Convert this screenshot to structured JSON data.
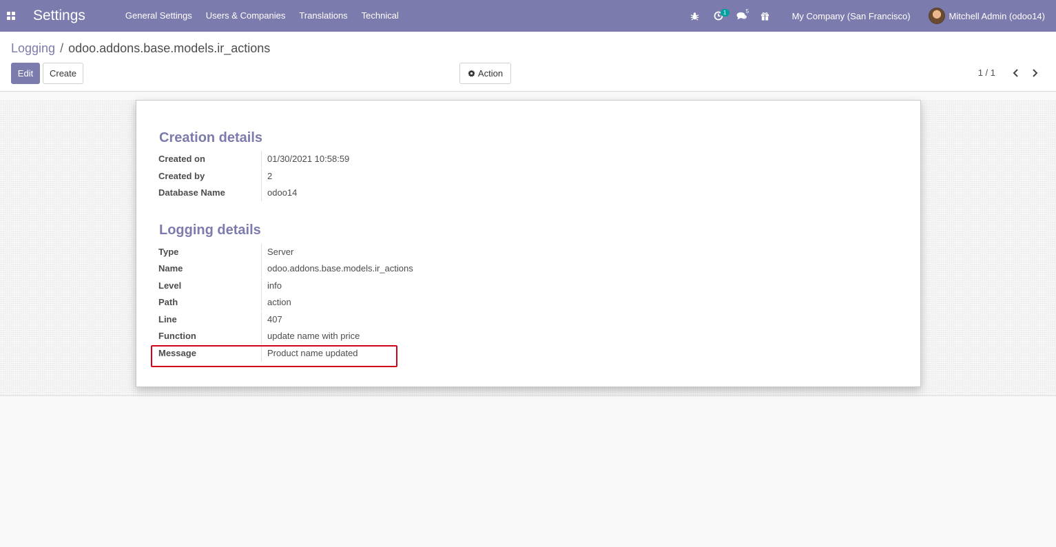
{
  "navbar": {
    "app_title": "Settings",
    "menu": [
      "General Settings",
      "Users & Companies",
      "Translations",
      "Technical"
    ],
    "activity_count": "1",
    "messages_count": "5",
    "company": "My Company (San Francisco)",
    "user": "Mitchell Admin (odoo14)"
  },
  "control_panel": {
    "breadcrumb_parent": "Logging",
    "breadcrumb_separator": "/",
    "breadcrumb_current": "odoo.addons.base.models.ir_actions",
    "edit_label": "Edit",
    "create_label": "Create",
    "action_label": "Action",
    "pager": "1 / 1"
  },
  "form": {
    "creation_title": "Creation details",
    "creation_fields": [
      {
        "label": "Created on",
        "value": "01/30/2021 10:58:59"
      },
      {
        "label": "Created by",
        "value": "2"
      },
      {
        "label": "Database Name",
        "value": "odoo14"
      }
    ],
    "logging_title": "Logging details",
    "logging_fields": [
      {
        "label": "Type",
        "value": "Server"
      },
      {
        "label": "Name",
        "value": "odoo.addons.base.models.ir_actions"
      },
      {
        "label": "Level",
        "value": "info"
      },
      {
        "label": "Path",
        "value": "action"
      },
      {
        "label": "Line",
        "value": "407"
      },
      {
        "label": "Function",
        "value": "update name with price"
      },
      {
        "label": "Message",
        "value": "Product name updated"
      }
    ]
  },
  "colors": {
    "brand": "#7c7bad",
    "badge": "#00a09d",
    "highlight": "#d00018"
  }
}
